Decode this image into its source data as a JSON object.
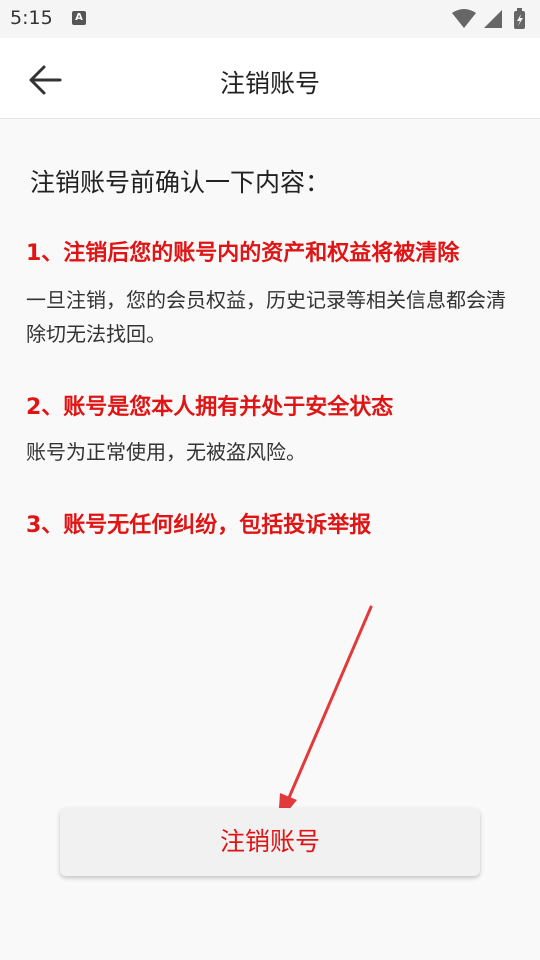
{
  "status_bar": {
    "time": "5:15",
    "notification_badge": "A"
  },
  "app_bar": {
    "title": "注销账号"
  },
  "content": {
    "heading": "注销账号前确认一下内容：",
    "items": [
      {
        "title": "1、注销后您的账号内的资产和权益将被清除",
        "description": "一旦注销，您的会员权益，历史记录等相关信息都会清除切无法找回。"
      },
      {
        "title": "2、账号是您本人拥有并处于安全状态",
        "description": "账号为正常使用，无被盗风险。"
      },
      {
        "title": "3、账号无任何纠纷，包括投诉举报",
        "description": ""
      }
    ]
  },
  "button": {
    "label": "注销账号"
  },
  "colors": {
    "accent_red": "#e01414",
    "annotation_arrow": "#e23a3a"
  }
}
